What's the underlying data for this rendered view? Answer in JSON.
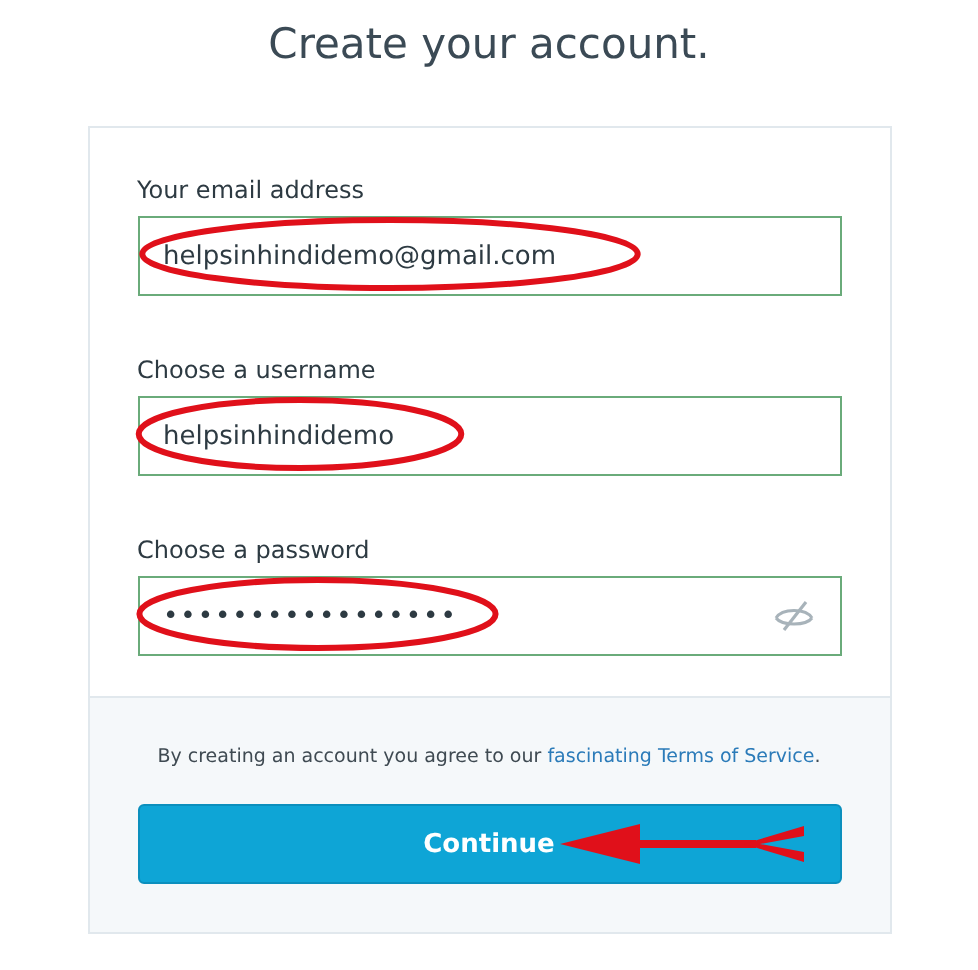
{
  "title": "Create your account.",
  "fields": [
    {
      "kind": "text",
      "label": "Your email address",
      "value": "helpsinhindidemo@gmail.com",
      "annotated": true
    },
    {
      "kind": "text",
      "label": "Choose a username",
      "value": "helpsinhindidemo",
      "annotated": true
    },
    {
      "kind": "password",
      "label": "Choose a password",
      "value": "•••••••••••••••••",
      "annotated": true
    }
  ],
  "terms": {
    "text": "By creating an account you agree to our",
    "link": "fascinating Terms of Service",
    "end": "."
  },
  "button": {
    "label": "Continue",
    "annotated": true
  }
}
